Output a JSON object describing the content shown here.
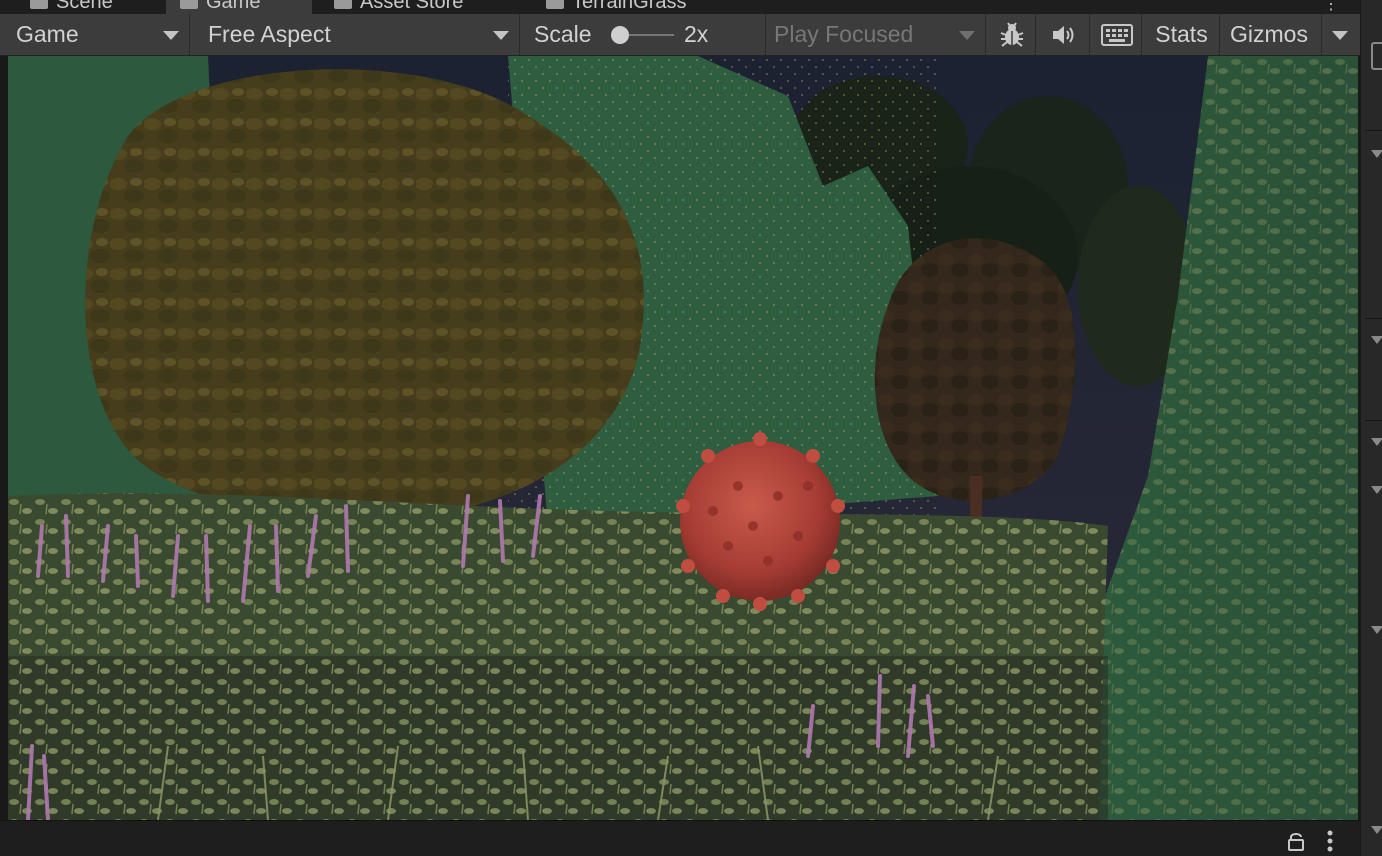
{
  "tabs": [
    {
      "label": "Scene",
      "icon": "hash-icon",
      "active": false
    },
    {
      "label": "Game",
      "icon": "gamepad-icon",
      "active": true
    },
    {
      "label": "Asset Store",
      "icon": "store-icon",
      "active": false
    },
    {
      "label": "TerrainGrass",
      "icon": "object-icon",
      "active": false
    }
  ],
  "toolbar": {
    "display_select": "Game",
    "aspect_select": "Free Aspect",
    "scale_label": "Scale",
    "scale_value": "2x",
    "scale_slider_level": 0.0,
    "play_mode_select": "Play Focused",
    "stats_label": "Stats",
    "gizmos_label": "Gizmos"
  },
  "icons": {
    "debug": "bug-icon",
    "audio": "speaker-icon",
    "grid": "keyboard-icon",
    "lock": "lock-icon",
    "menu": "kebab-menu-icon"
  },
  "colors": {
    "toolbar_bg": "#3c3c3c",
    "tab_bg": "#1e1e1e",
    "text": "#d2d2d2",
    "disabled_text": "#777777",
    "virus_red": "#b8483c"
  }
}
